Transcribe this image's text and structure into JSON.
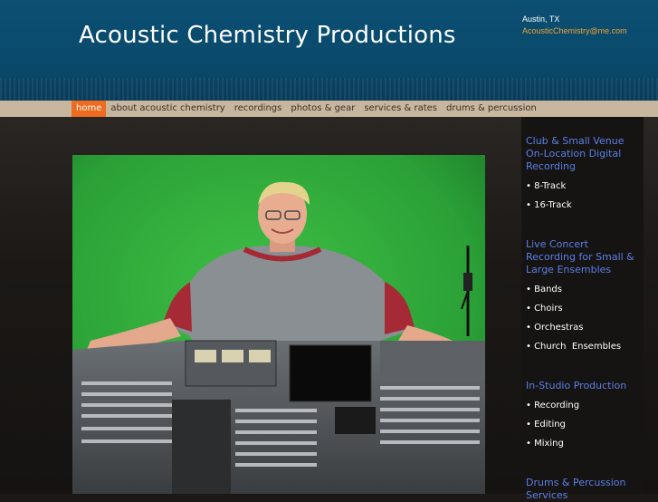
{
  "header": {
    "title": "Acoustic Chemistry Productions",
    "location": "Austin, TX",
    "email": "AcousticChemistry@me.com"
  },
  "nav": {
    "items": [
      {
        "label": "home",
        "active": true
      },
      {
        "label": "about acoustic chemistry",
        "active": false
      },
      {
        "label": "recordings",
        "active": false
      },
      {
        "label": "photos & gear",
        "active": false
      },
      {
        "label": "services & rates",
        "active": false
      },
      {
        "label": "drums & percussion",
        "active": false
      }
    ]
  },
  "sidebar": {
    "sections": [
      {
        "heading": "Club & Small Venue On-Location Digital Recording",
        "items": [
          "• 8-Track",
          "• 16-Track"
        ]
      },
      {
        "heading": "Live Concert Recording for Small & Large Ensembles",
        "items": [
          "• Bands",
          "• Choirs",
          "• Orchestras",
          "• Church  Ensembles"
        ]
      },
      {
        "heading": "In-Studio Production",
        "items": [
          "• Recording",
          "• Editing",
          "• Mixing"
        ]
      },
      {
        "heading": "Drums & Percussion Services",
        "items": []
      }
    ]
  },
  "colors": {
    "header_bg": "#0b4f73",
    "nav_bg": "#c8b79e",
    "nav_active": "#ef6b1f",
    "sidebar_heading": "#5a7fe8",
    "email": "#f0a030",
    "photo_backdrop": "#2fa53a"
  },
  "photo": {
    "subject": "man-at-mixing-console"
  }
}
